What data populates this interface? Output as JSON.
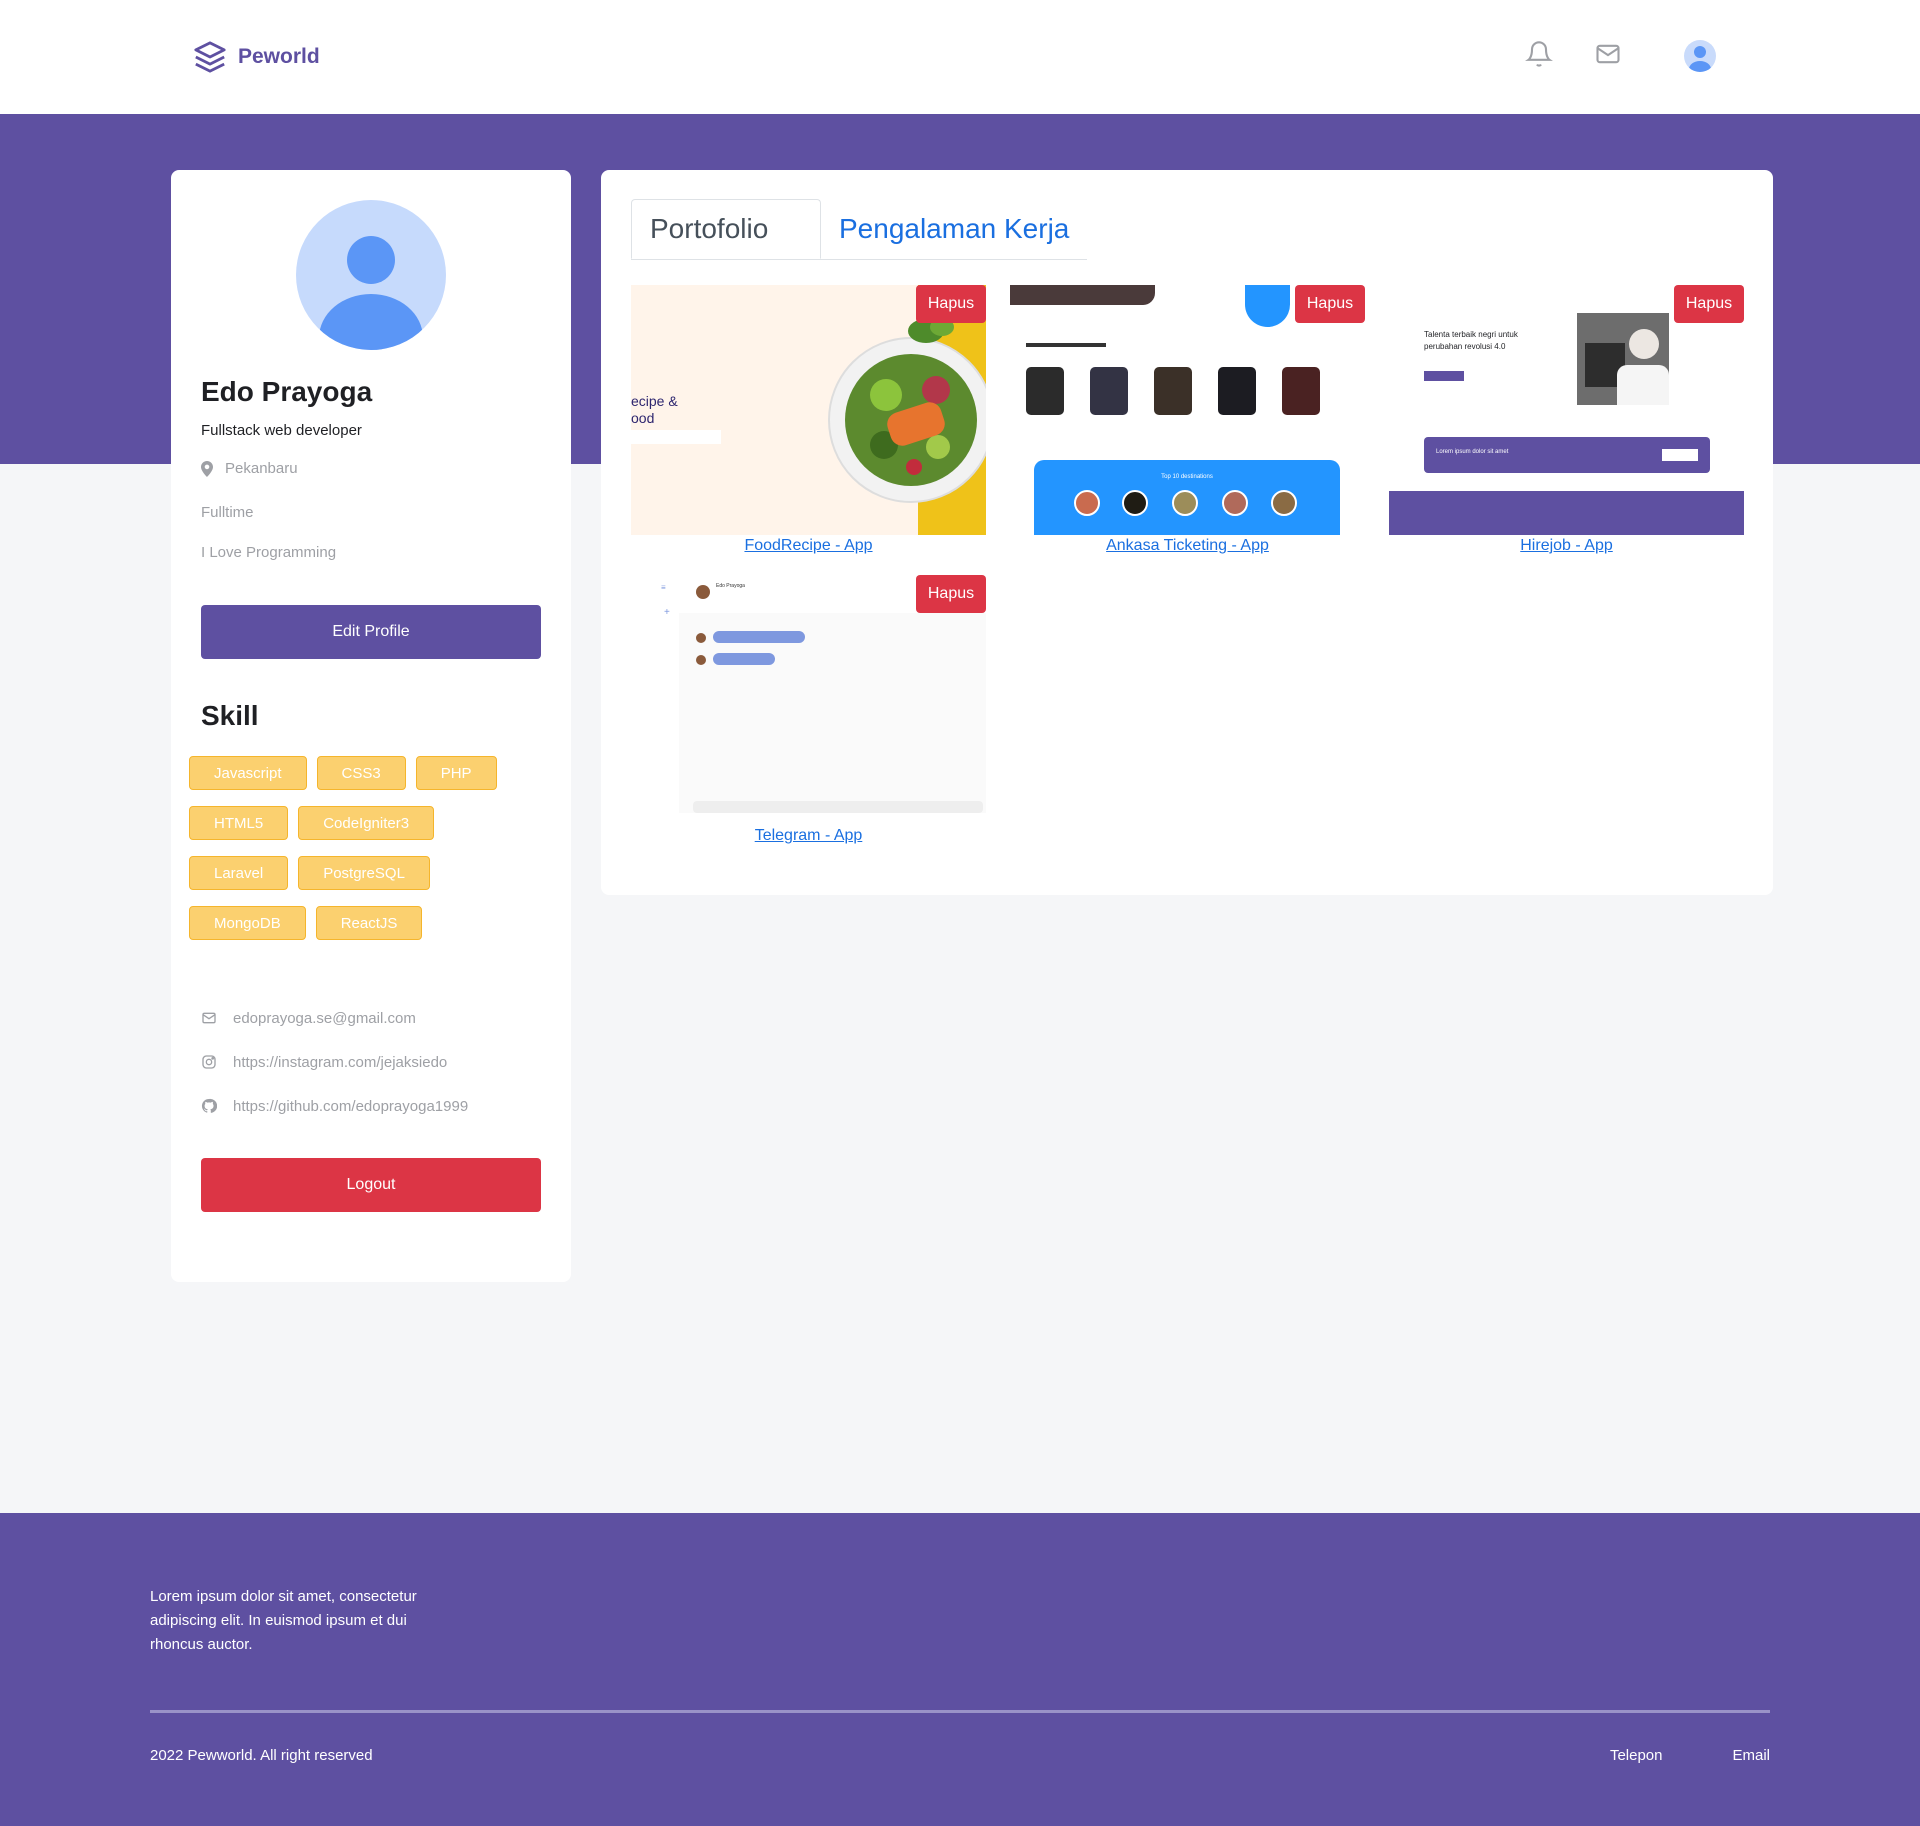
{
  "navbar": {
    "brand": "Peworld",
    "icons": [
      "bell-icon",
      "mail-icon",
      "user-avatar"
    ]
  },
  "profile": {
    "name": "Edo Prayoga",
    "role": "Fullstack web developer",
    "location": "Pekanbaru",
    "job_type": "Fulltime",
    "bio": "I Love Programming",
    "edit_label": "Edit Profile",
    "skill_title": "Skill",
    "skills": [
      "Javascript",
      "CSS3",
      "PHP",
      "HTML5",
      "CodeIgniter3",
      "Laravel",
      "PostgreSQL",
      "MongoDB",
      "ReactJS"
    ],
    "email": "edoprayoga.se@gmail.com",
    "instagram": "https://instagram.com/jejaksiedo",
    "github": "https://github.com/edoprayoga1999",
    "logout_label": "Logout"
  },
  "portfolio": {
    "tabs": [
      "Portofolio",
      "Pengalaman Kerja"
    ],
    "delete_label": "Hapus",
    "items": [
      {
        "title": "FoodRecipe - App",
        "thumb_text": "ecipe &\nood"
      },
      {
        "title": "Ankasa Ticketing - App",
        "thumb_text": "Top 10 destinations"
      },
      {
        "title": "Hirejob - App",
        "thumb_text": "Talenta terbaik negri untuk perubahan revolusi 4.0",
        "banner_text": "Lorem ipsum dolor sit amet"
      },
      {
        "title": "Telegram - App",
        "thumb_text": "Edo Prayoga"
      }
    ]
  },
  "footer": {
    "description": "Lorem ipsum dolor sit amet, consectetur adipiscing elit. In euismod ipsum et dui rhoncus auctor.",
    "copyright": "2022 Pewworld. All right reserved",
    "links": [
      "Telepon",
      "Email"
    ]
  },
  "colors": {
    "primary": "#5e50a1",
    "danger": "#dc3545",
    "skill": "#fbd06f",
    "link": "#1a6fe0"
  }
}
